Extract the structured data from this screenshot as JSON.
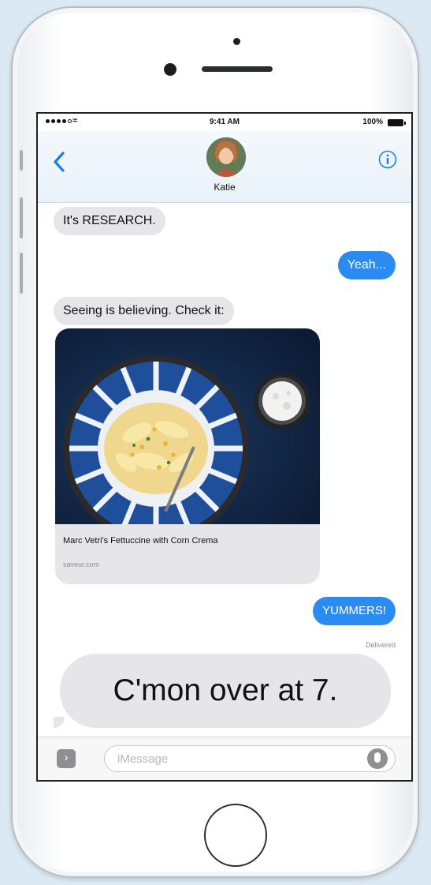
{
  "status_bar": {
    "time": "9:41 AM",
    "battery": "100%"
  },
  "header": {
    "contact_name": "Katie",
    "back_icon": "chevron-left-icon",
    "info_icon": "info-icon"
  },
  "conversation": {
    "messages": [
      {
        "direction": "incoming",
        "text": "It's RESEARCH."
      },
      {
        "direction": "outgoing",
        "text": "Yeah..."
      },
      {
        "direction": "incoming",
        "text": "Seeing is believing. Check it:"
      },
      {
        "direction": "outgoing",
        "text": "YUMMERS!"
      },
      {
        "direction": "incoming",
        "text": "C'mon over at 7."
      }
    ],
    "rich_link": {
      "title": "Marc Vetri's Fettuccine with Corn Crema",
      "domain": "saveur.com"
    },
    "delivery_status": "Delivered"
  },
  "input_bar": {
    "placeholder": "iMessage",
    "app_drawer_icon": "chevron-right-icon",
    "mic_icon": "microphone-icon"
  },
  "colors": {
    "outgoing_bubble": "#2a8cf2",
    "incoming_bubble": "#e5e5ea",
    "accent": "#1a7cf5",
    "background": "#dbe9f4"
  }
}
